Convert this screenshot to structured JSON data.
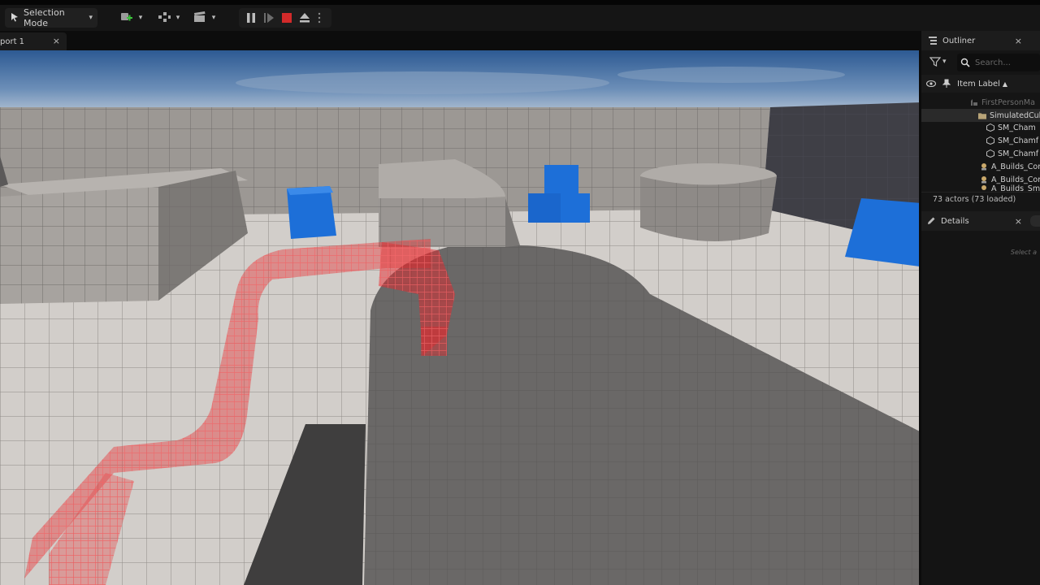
{
  "toolbar": {
    "mode_label": "Selection Mode",
    "icons": [
      "mode-icon",
      "add-actor-icon",
      "snap-icon",
      "cinematics-icon",
      "pause-icon",
      "step-icon",
      "stop-icon",
      "eject-icon",
      "more-icon"
    ]
  },
  "viewport_tab": {
    "label": "port 1",
    "close": "×"
  },
  "outliner": {
    "title": "Outliner",
    "close": "×",
    "search_placeholder": "Search...",
    "column_label": "Item Label",
    "sort_arrow": "▲",
    "items": [
      {
        "label": "FirstPersonMa",
        "type": "level"
      },
      {
        "label": "SimulatedCub",
        "type": "folder"
      },
      {
        "label": "SM_Cham",
        "type": "mesh"
      },
      {
        "label": "SM_Chamf",
        "type": "mesh"
      },
      {
        "label": "SM_Chamf",
        "type": "mesh"
      },
      {
        "label": "A_Builds_Cor",
        "type": "actor"
      },
      {
        "label": "A_Builds_Cor",
        "type": "actor"
      },
      {
        "label": "A_Builds_Sm",
        "type": "actor"
      }
    ],
    "status": "73 actors (73 loaded)"
  },
  "details": {
    "title": "Details",
    "close": "×",
    "hint": "Select a"
  },
  "colors": {
    "accent_red": "#e8272b",
    "cube_blue": "#1d6fd8",
    "panel_bg": "#151515",
    "stop_red": "#d22a2a"
  }
}
